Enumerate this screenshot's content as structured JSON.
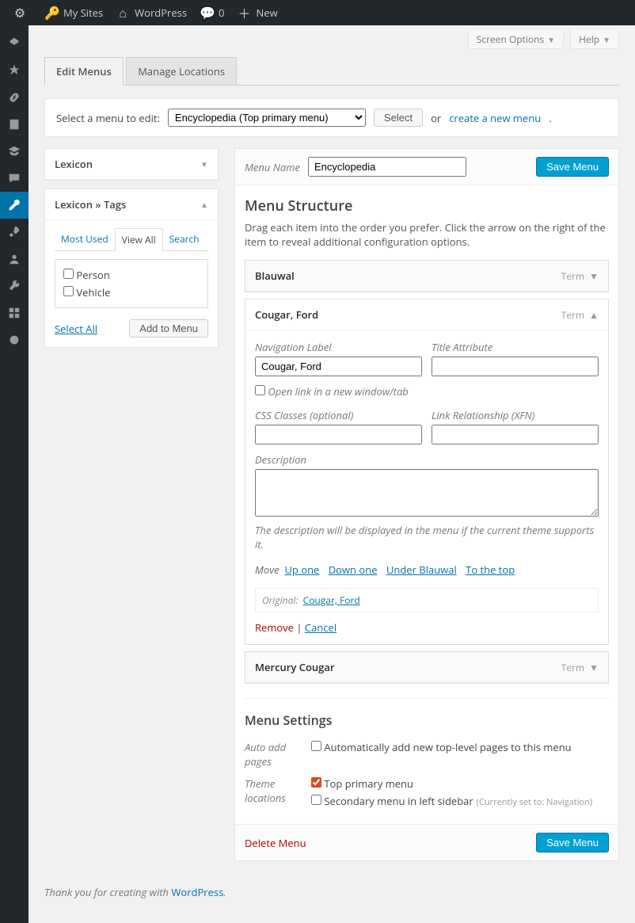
{
  "adminbar": {
    "mysites": "My Sites",
    "sitename": "WordPress",
    "comments": "0",
    "new": "New"
  },
  "top": {
    "screen_options": "Screen Options",
    "help": "Help"
  },
  "tabs": {
    "edit": "Edit Menus",
    "locations": "Manage Locations"
  },
  "selectbar": {
    "label": "Select a menu to edit:",
    "selected": "Encyclopedia (Top primary menu)",
    "select_btn": "Select",
    "or": "or",
    "create": "create a new menu"
  },
  "sidebar": {
    "box1_title": "Lexicon",
    "box2_title": "Lexicon » Tags",
    "subtab_most": "Most Used",
    "subtab_all": "View All",
    "subtab_search": "Search",
    "tag1": "Person",
    "tag2": "Vehicle",
    "select_all": "Select All",
    "add_btn": "Add to Menu"
  },
  "menuhead": {
    "label": "Menu Name",
    "value": "Encyclopedia",
    "save": "Save Menu"
  },
  "structure": {
    "title": "Menu Structure",
    "hint": "Drag each item into the order you prefer. Click the arrow on the right of the item to reveal additional configuration options.",
    "type_label": "Term"
  },
  "items": {
    "i1": "Blauwal",
    "i2": "Cougar, Ford",
    "i3": "Mercury Cougar"
  },
  "item2_settings": {
    "nav_label_lbl": "Navigation Label",
    "nav_label_val": "Cougar, Ford",
    "title_attr_lbl": "Title Attribute",
    "title_attr_val": "",
    "open_new": "Open link in a new window/tab",
    "css_lbl": "CSS Classes (optional)",
    "css_val": "",
    "xfn_lbl": "Link Relationship (XFN)",
    "xfn_val": "",
    "desc_lbl": "Description",
    "desc_val": "",
    "desc_note": "The description will be displayed in the menu if the current theme supports it.",
    "move_lbl": "Move",
    "move_up": "Up one",
    "move_down": "Down one",
    "move_under": "Under Blauwal",
    "move_top": "To the top",
    "orig_lbl": "Original:",
    "orig_link": "Cougar, Ford",
    "remove": "Remove",
    "cancel": "Cancel"
  },
  "settings": {
    "title": "Menu Settings",
    "auto_lbl": "Auto add pages",
    "auto_opt": "Automatically add new top-level pages to this menu",
    "loc_lbl": "Theme locations",
    "loc1": "Top primary menu",
    "loc2": "Secondary menu in left sidebar",
    "loc2_note": "(Currently set to: Navigation)"
  },
  "footer": {
    "delete": "Delete Menu",
    "save": "Save Menu"
  },
  "pagefoot": {
    "thank": "Thank you for creating with ",
    "wp": "WordPress"
  }
}
